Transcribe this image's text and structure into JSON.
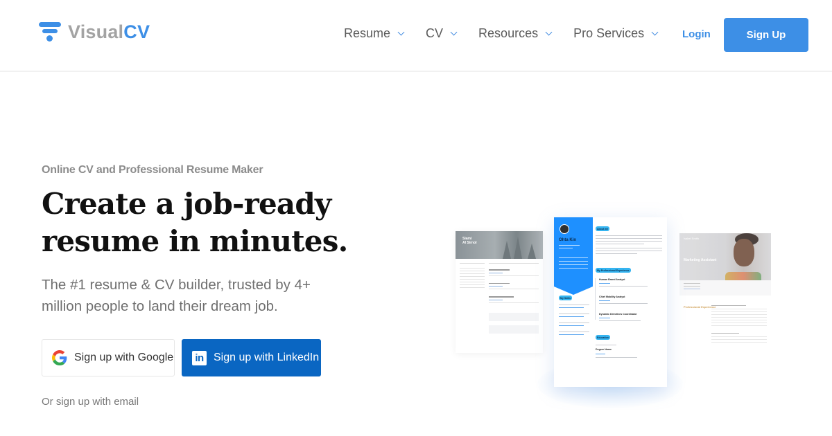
{
  "header": {
    "logo": {
      "part1": "Visual",
      "part2": "CV"
    },
    "nav": [
      {
        "label": "Resume"
      },
      {
        "label": "CV"
      },
      {
        "label": "Resources"
      },
      {
        "label": "Pro Services"
      }
    ],
    "login_label": "Login",
    "signup_label": "Sign Up"
  },
  "hero": {
    "eyebrow": "Online CV and Professional Resume Maker",
    "headline_line1": "Create a job-ready",
    "headline_line2": "resume in minutes.",
    "subtitle": "The #1 resume & CV builder, trusted by 4+ million people to land their dream job.",
    "google_button": "Sign up with Google",
    "linkedin_button": "Sign up with LinkedIn",
    "email_link": "Or sign up with email"
  },
  "previews": {
    "left": {
      "name_line1": "Siami",
      "name_line2": "Al Sirnol"
    },
    "center": {
      "name": "Ohta Kin",
      "about_tag": "About me",
      "experience_tag": "My Professional Experience",
      "skills_tag": "My Skills",
      "education_tag": "Education",
      "jobs": [
        "Human Brand Analyst",
        "Chief Mobility Analyst",
        "Dynamic Directives Coordinator"
      ],
      "degree": "Degree Name"
    },
    "right": {
      "name": "Isabel Smith",
      "title": "Marketing Assistant",
      "section": "Professional Experience"
    }
  },
  "colors": {
    "brand_blue": "#3d8fe6",
    "linkedin_blue": "#0a66c2",
    "heading": "#111111",
    "muted": "#8c8c8c"
  }
}
